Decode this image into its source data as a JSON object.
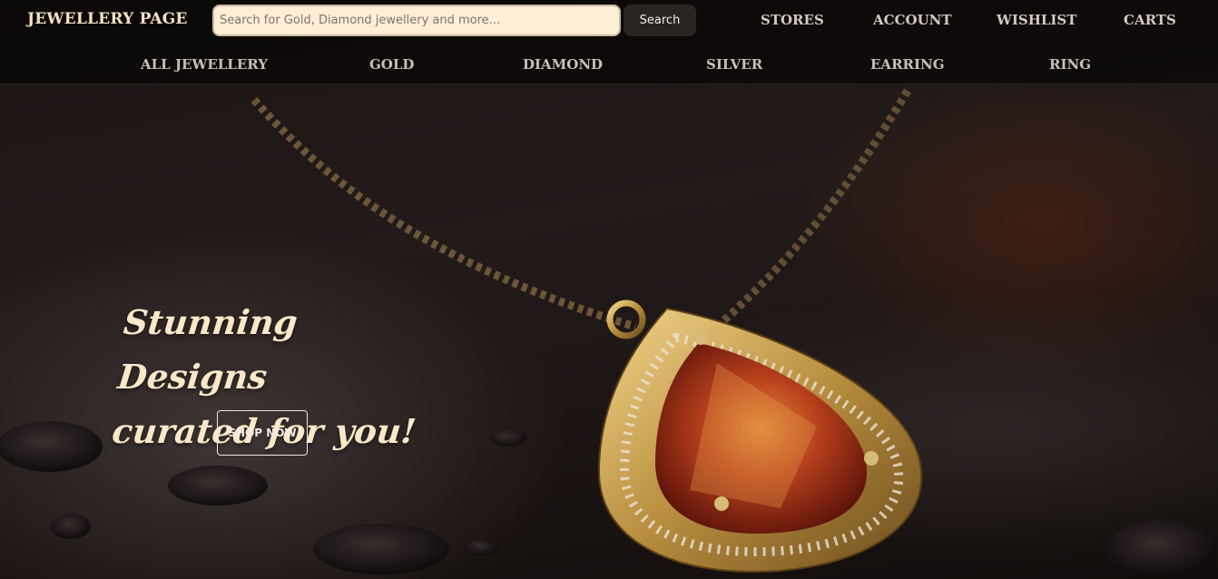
{
  "header": {
    "brand": "JEWELLERY PAGE",
    "search": {
      "placeholder": "Search for Gold, Diamond jewellery and more...",
      "value": "",
      "button_label": "Search"
    },
    "links": [
      "STORES",
      "ACCOUNT",
      "WISHLIST",
      "CARTS"
    ]
  },
  "categories": [
    "ALL JEWELLERY",
    "GOLD",
    "DIAMOND",
    "SILVER",
    "EARRING",
    "RING"
  ],
  "hero": {
    "headline_line1": "Stunning Designs",
    "headline_line2": "curated for you!",
    "cta_label": "SHOP NOW"
  },
  "colors": {
    "brand_text": "#f6e3c2",
    "search_bg": "#fdeed5",
    "gold": "#c9a45a",
    "gem": "#a8321a"
  },
  "icons": {
    "hero_image": "pendant-necklace-image"
  }
}
